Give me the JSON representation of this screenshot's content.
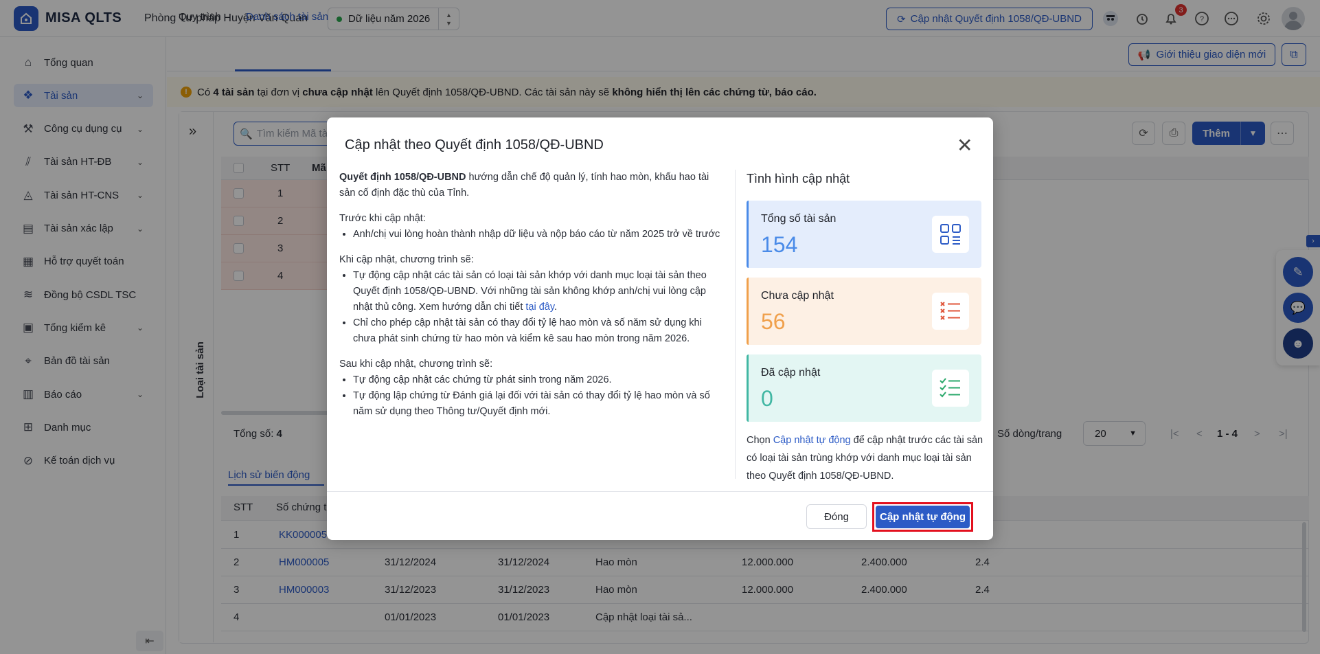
{
  "header": {
    "logo_letter": "",
    "app_name": "MISA QLTS",
    "unit_name": "Phòng Tư pháp Huyện Văn Quan",
    "year_label": "Dữ liệu năm 2026",
    "update_button": "Cập nhật Quyết định 1058/QĐ-UBND",
    "notification_count": "3",
    "icons": [
      "user-secret-icon",
      "alarm-icon",
      "bell-icon",
      "help-icon",
      "chat-icon",
      "settings-icon",
      "avatar"
    ]
  },
  "sidebar": {
    "items": [
      {
        "label": "Tổng quan",
        "icon": "home-icon",
        "has_children": false,
        "active": false
      },
      {
        "label": "Tài sản",
        "icon": "asset-icon",
        "has_children": true,
        "active": true
      },
      {
        "label": "Công cụ dụng cụ",
        "icon": "tool-icon",
        "has_children": true,
        "active": false
      },
      {
        "label": "Tài sản HT-ĐB",
        "icon": "road-icon",
        "has_children": true,
        "active": false
      },
      {
        "label": "Tài sản HT-CNS",
        "icon": "water-icon",
        "has_children": true,
        "active": false
      },
      {
        "label": "Tài sản xác lập",
        "icon": "doc-icon",
        "has_children": true,
        "active": false
      },
      {
        "label": "Hỗ trợ quyết toán",
        "icon": "report-icon",
        "has_children": false,
        "active": false
      },
      {
        "label": "Đồng bộ CSDL TSC",
        "icon": "sync-icon",
        "has_children": false,
        "active": false
      },
      {
        "label": "Tổng kiểm kê",
        "icon": "clipboard-icon",
        "has_children": true,
        "active": false
      },
      {
        "label": "Bản đồ tài sản",
        "icon": "map-icon",
        "has_children": false,
        "active": false
      },
      {
        "label": "Báo cáo",
        "icon": "chart-icon",
        "has_children": true,
        "active": false
      },
      {
        "label": "Danh mục",
        "icon": "grid-icon",
        "has_children": false,
        "active": false
      },
      {
        "label": "Kế toán dịch vụ",
        "icon": "service-icon",
        "has_children": false,
        "active": false
      }
    ]
  },
  "tabs": [
    "Quy trình",
    "Danh sách tài sản"
  ],
  "intro_button": "Giới thiệu giao diện mới",
  "warning": {
    "p1": "Có ",
    "b1": "4 tài sản",
    "p2": " tại đơn vị ",
    "b2": "chưa cập nhật",
    "p3": " lên Quyết định 1058/QĐ-UBND. Các tài sản này sẽ ",
    "b3": "không hiển thị lên các chứng từ, báo cáo."
  },
  "asset_panel": {
    "vertical_label": "Loại tài sản",
    "search_placeholder": "Tìm kiếm Mã tà",
    "columns": [
      "STT",
      "Mã"
    ],
    "rows": [
      "1",
      "2",
      "3",
      "4"
    ],
    "add_button": "Thêm",
    "total_label": "Tổng số: ",
    "total_value": "4",
    "rows_per_page_label": "Số dòng/trang",
    "rows_per_page": "20",
    "page_range": "1 - 4"
  },
  "history": {
    "tab_label": "Lịch sử biến động",
    "columns": [
      "STT",
      "Số chứng t"
    ],
    "rows": [
      {
        "stt": "1",
        "doc": "KK000005",
        "d1": "",
        "d2": "",
        "type": "",
        "v1": "",
        "v2": "",
        "v3": ""
      },
      {
        "stt": "2",
        "doc": "HM000005",
        "d1": "31/12/2024",
        "d2": "31/12/2024",
        "type": "Hao mòn",
        "v1": "12.000.000",
        "v2": "2.400.000",
        "v3": "2.4"
      },
      {
        "stt": "3",
        "doc": "HM000003",
        "d1": "31/12/2023",
        "d2": "31/12/2023",
        "type": "Hao mòn",
        "v1": "12.000.000",
        "v2": "2.400.000",
        "v3": "2.4"
      },
      {
        "stt": "4",
        "doc": "",
        "d1": "01/01/2023",
        "d2": "01/01/2023",
        "type": "Cập nhật loại tài sả...",
        "v1": "",
        "v2": "",
        "v3": ""
      }
    ]
  },
  "modal": {
    "title": "Cập nhật theo Quyết định 1058/QĐ-UBND",
    "intro_bold": "Quyết định 1058/QĐ-UBND",
    "intro_rest": " hướng dẫn chế độ quản lý, tính hao mòn, khấu hao tài sản cố định đặc thù của Tỉnh.",
    "before_title": "Trước khi cập nhật:",
    "before_items": [
      "Anh/chị vui lòng hoàn thành nhập dữ liệu và nộp báo cáo từ năm 2025 trở về trước"
    ],
    "during_title": "Khi cập nhật, chương trình sẽ:",
    "during_item1": "Tự động cập nhật các tài sản có loại tài sản khớp với danh mục loại tài sản theo Quyết định 1058/QĐ-UBND. Với những tài sản không khớp anh/chị vui lòng cập nhật thủ công. Xem hướng dẫn chi tiết ",
    "during_item1_link": "tại đây",
    "during_item1_end": ".",
    "during_item2": "Chỉ cho phép cập nhật tài sản có thay đổi tỷ lệ hao mòn và số năm sử dụng khi chưa phát sinh chứng từ hao mòn và kiểm kê sau hao mòn trong năm 2026.",
    "after_title": "Sau khi cập nhật, chương trình sẽ:",
    "after_items": [
      "Tự động cập nhật các chứng từ phát sinh trong năm 2026.",
      "Tự động lập chứng từ Đánh giá lại đối với tài sản có thay đổi tỷ lệ hao mòn và số năm sử dụng theo Thông tư/Quyết định mới."
    ],
    "status_title": "Tình hình cập nhật",
    "stats": [
      {
        "label": "Tổng số tài sản",
        "value": "154",
        "color": "#4a8be8",
        "bg": "#e4edfc",
        "bar": "#4a8be8",
        "icon": "grid-list-icon"
      },
      {
        "label": "Chưa cập nhật",
        "value": "56",
        "color": "#f0a04b",
        "bg": "#fdf0e4",
        "bar": "#f0a04b",
        "icon": "x-list-icon"
      },
      {
        "label": "Đã cập nhật",
        "value": "0",
        "color": "#41b7a3",
        "bg": "#e3f6f3",
        "bar": "#41b7a3",
        "icon": "check-list-icon"
      }
    ],
    "note_p1": "Chọn ",
    "note_link": "Cập nhật tự động",
    "note_p2": " để cập nhật trước các tài sản có loại tài sản trùng khớp với danh mục loại tài sản theo Quyết định 1058/QĐ-UBND.",
    "close_button": "Đóng",
    "auto_button": "Cập nhật tự động"
  },
  "colors": {
    "accent": "#2c5bc6",
    "highlight": "#e3101e",
    "warning_row": "#fde8e3"
  }
}
